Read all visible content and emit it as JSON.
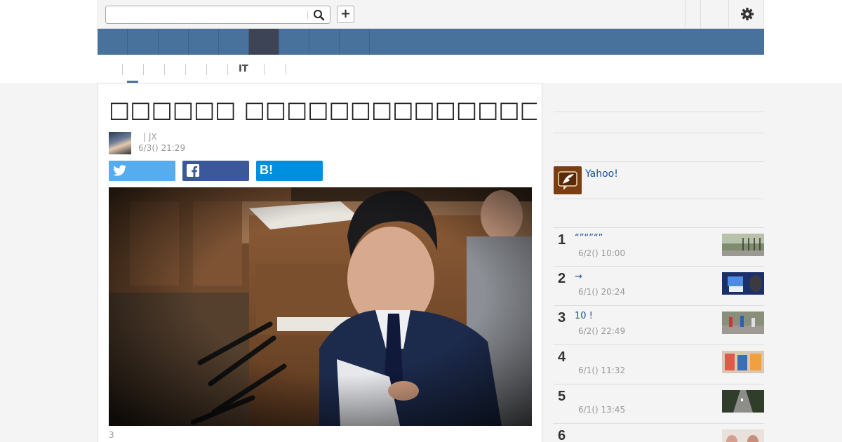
{
  "header": {
    "search_placeholder": "",
    "search_icon": "search-icon",
    "plus_label": "+",
    "settings_icon": "gear-icon"
  },
  "subnav": {
    "items": [
      "",
      "",
      "",
      "",
      "",
      "IT",
      ""
    ]
  },
  "article": {
    "headline": "□□□□□□ □□□□□□□□□□□□□□□□□JX□□□ □□□□□□",
    "author": "| JX",
    "date": "6/3() 21:29",
    "caption": "3",
    "share": {
      "twitter_icon": "twitter-icon",
      "facebook_icon": "facebook-icon",
      "hatena_label": "B!"
    }
  },
  "sidebar": {
    "yahoo_label": "Yahoo!",
    "ranking": [
      {
        "rank": "1",
        "title": "“”“”“”",
        "date": "6/2() 10:00"
      },
      {
        "rank": "2",
        "title": "→",
        "date": "6/1() 20:24"
      },
      {
        "rank": "3",
        "title": "10 !",
        "date": "6/2() 22:49"
      },
      {
        "rank": "4",
        "title": "",
        "date": "6/1() 11:32"
      },
      {
        "rank": "5",
        "title": "",
        "date": "6/1() 13:45"
      },
      {
        "rank": "6",
        "title": "",
        "date": ""
      }
    ]
  },
  "colors": {
    "nav": "#48719c",
    "nav_active": "#3d4455",
    "link": "#1b4f9a",
    "twitter": "#55acee",
    "facebook": "#3b5998",
    "hatena": "#008fde"
  }
}
